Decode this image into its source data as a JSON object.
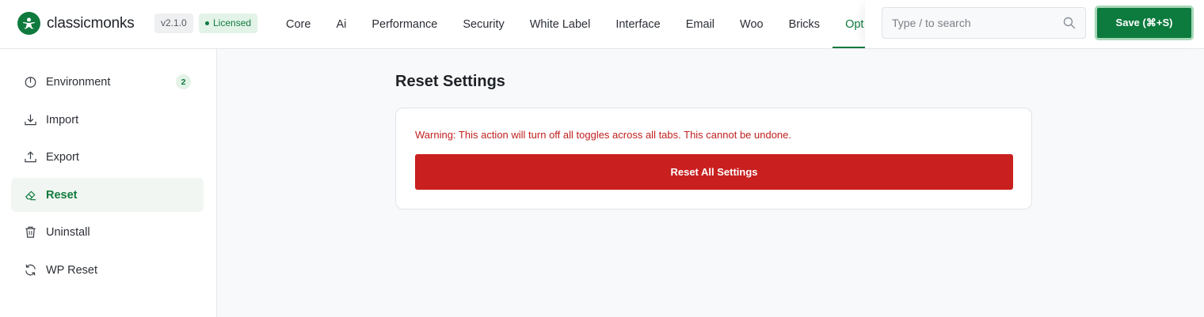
{
  "header": {
    "brand_name": "classicmonks",
    "version": "v2.1.0",
    "license_status": "Licensed",
    "nav_tabs": [
      {
        "label": "Core"
      },
      {
        "label": "Ai"
      },
      {
        "label": "Performance"
      },
      {
        "label": "Security"
      },
      {
        "label": "White Label"
      },
      {
        "label": "Interface"
      },
      {
        "label": "Email"
      },
      {
        "label": "Woo"
      },
      {
        "label": "Bricks"
      },
      {
        "label": "Opt"
      }
    ],
    "active_tab": "Opt",
    "search": {
      "placeholder": "Type / to search",
      "value": ""
    },
    "save_label": "Save (⌘+S)"
  },
  "sidebar": {
    "items": [
      {
        "label": "Environment",
        "icon": "power-icon",
        "count": "2"
      },
      {
        "label": "Import",
        "icon": "download-icon"
      },
      {
        "label": "Export",
        "icon": "upload-icon"
      },
      {
        "label": "Reset",
        "icon": "eraser-icon",
        "active": true
      },
      {
        "label": "Uninstall",
        "icon": "trash-icon"
      },
      {
        "label": "WP Reset",
        "icon": "refresh-icon"
      }
    ]
  },
  "main": {
    "title": "Reset Settings",
    "warning": "Warning: This action will turn off all toggles across all tabs. This cannot be undone.",
    "reset_button_label": "Reset All Settings"
  },
  "colors": {
    "brand": "#0f7a3e",
    "danger": "#c91f1f",
    "warning_text": "#c0201f"
  }
}
